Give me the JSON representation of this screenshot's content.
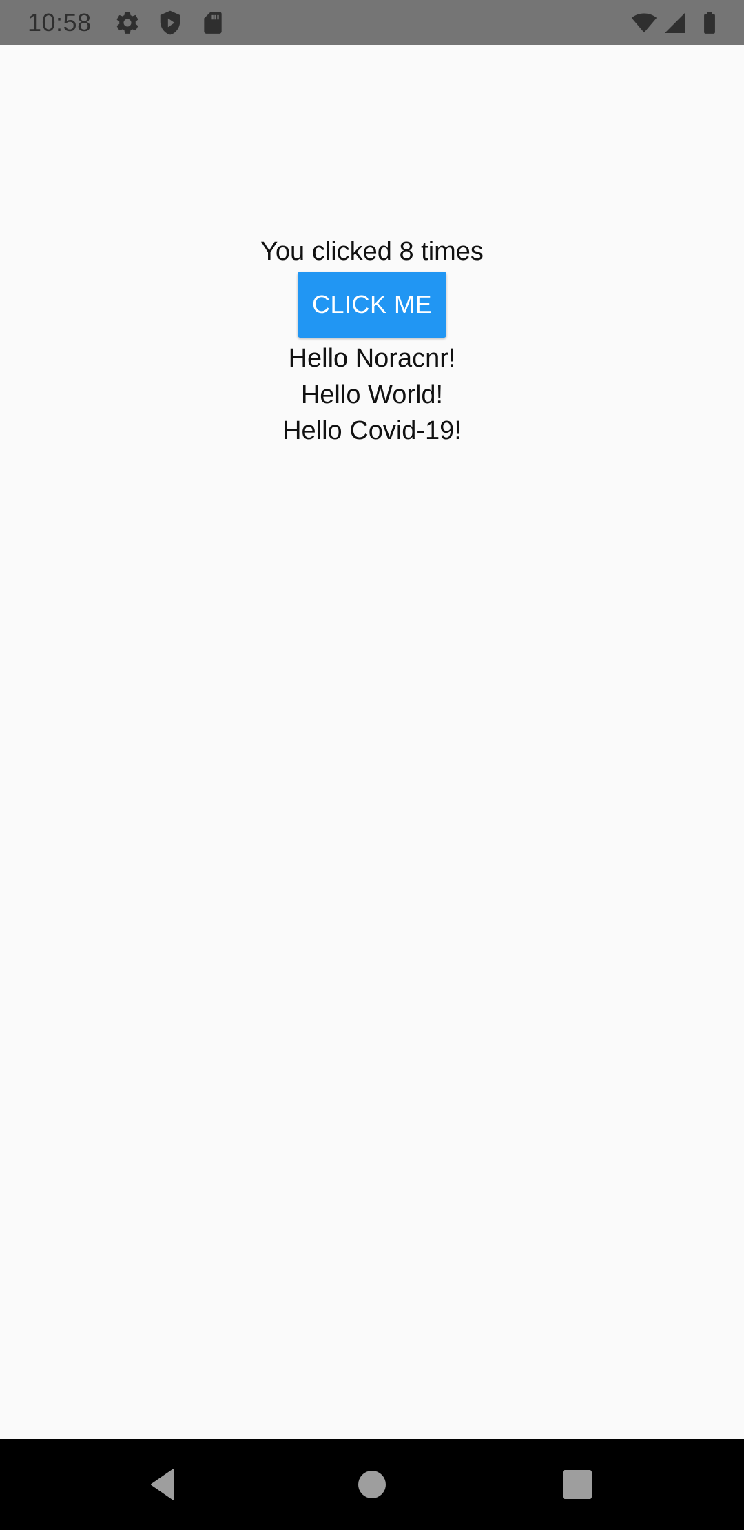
{
  "status_bar": {
    "time": "10:58",
    "icons": [
      "gear-icon",
      "shield-play-icon",
      "sd-card-icon",
      "wifi-icon",
      "cell-signal-icon",
      "battery-icon"
    ]
  },
  "main": {
    "click_count_text": "You clicked 8 times",
    "button_label": "CLICK ME",
    "greetings": [
      "Hello Noracnr!",
      "Hello World!",
      "Hello Covid-19!"
    ]
  },
  "nav_bar": {
    "icons": [
      "back-icon",
      "home-icon",
      "recents-icon"
    ]
  },
  "colors": {
    "button": "#2196f3",
    "status_bar": "#757575",
    "background": "#fafafa",
    "nav_bar": "#000000"
  }
}
